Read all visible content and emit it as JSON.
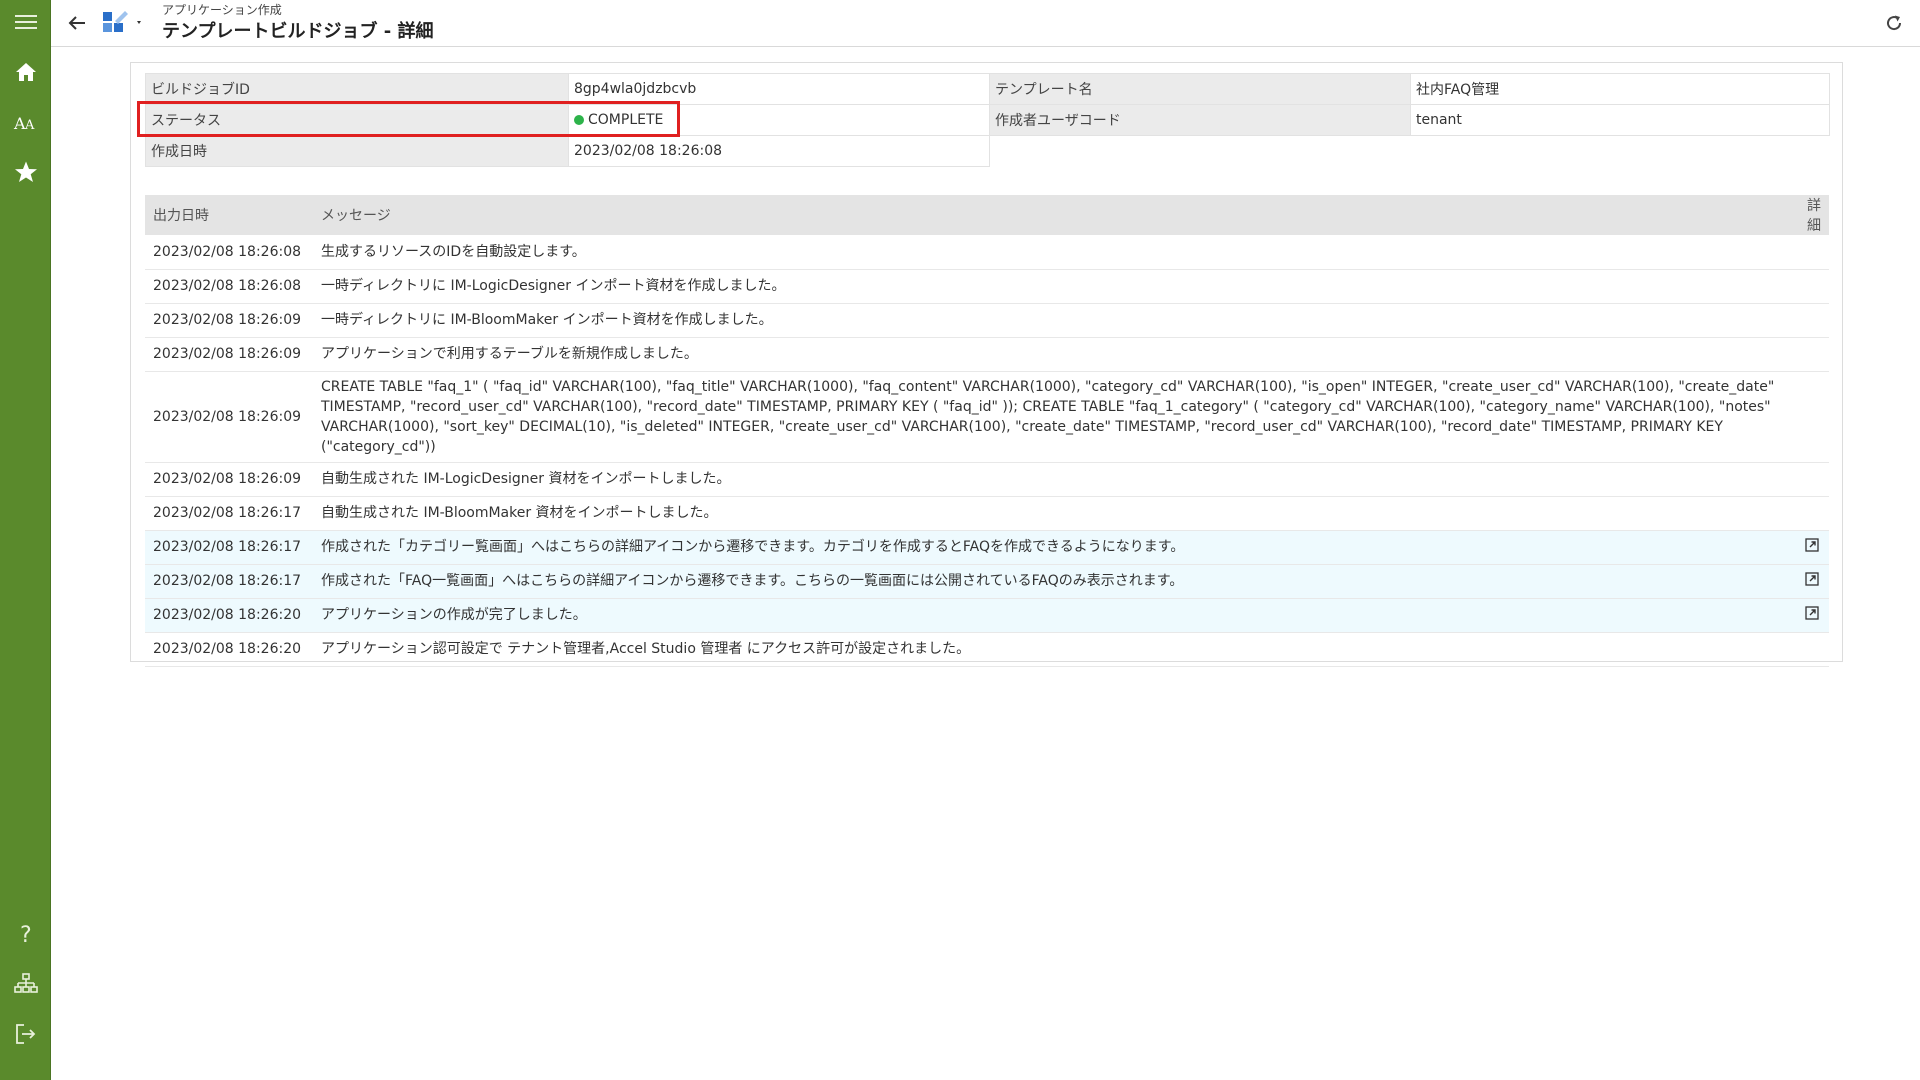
{
  "header": {
    "subtitle": "アプリケーション作成",
    "title": "テンプレートビルドジョブ - 詳細"
  },
  "info": {
    "build_job_id_label": "ビルドジョブID",
    "build_job_id": "8gp4wla0jdzbcvb",
    "status_label": "ステータス",
    "status": "COMPLETE",
    "created_at_label": "作成日時",
    "created_at": "2023/02/08 18:26:08",
    "template_name_label": "テンプレート名",
    "template_name": "社内FAQ管理",
    "creator_label": "作成者ユーザコード",
    "creator": "tenant"
  },
  "messages": {
    "columns": {
      "time": "出力日時",
      "message": "メッセージ",
      "detail": "詳細"
    },
    "rows": [
      {
        "time": "2023/02/08 18:26:08",
        "text": "生成するリソースのIDを自動設定します。",
        "link": false
      },
      {
        "time": "2023/02/08 18:26:08",
        "text": "一時ディレクトリに IM-LogicDesigner インポート資材を作成しました。",
        "link": false
      },
      {
        "time": "2023/02/08 18:26:09",
        "text": "一時ディレクトリに IM-BloomMaker インポート資材を作成しました。",
        "link": false
      },
      {
        "time": "2023/02/08 18:26:09",
        "text": "アプリケーションで利用するテーブルを新規作成しました。",
        "link": false
      },
      {
        "time": "2023/02/08 18:26:09",
        "text": "CREATE TABLE \"faq_1\" ( \"faq_id\" VARCHAR(100), \"faq_title\" VARCHAR(1000), \"faq_content\" VARCHAR(1000), \"category_cd\" VARCHAR(100), \"is_open\" INTEGER, \"create_user_cd\" VARCHAR(100), \"create_date\" TIMESTAMP, \"record_user_cd\" VARCHAR(100), \"record_date\" TIMESTAMP, PRIMARY KEY ( \"faq_id\" )); CREATE TABLE \"faq_1_category\" ( \"category_cd\" VARCHAR(100), \"category_name\" VARCHAR(100), \"notes\" VARCHAR(1000), \"sort_key\" DECIMAL(10), \"is_deleted\" INTEGER, \"create_user_cd\" VARCHAR(100), \"create_date\" TIMESTAMP, \"record_user_cd\" VARCHAR(100), \"record_date\" TIMESTAMP, PRIMARY KEY (\"category_cd\"))",
        "link": false
      },
      {
        "time": "2023/02/08 18:26:09",
        "text": "自動生成された IM-LogicDesigner 資材をインポートしました。",
        "link": false
      },
      {
        "time": "2023/02/08 18:26:17",
        "text": "自動生成された IM-BloomMaker 資材をインポートしました。",
        "link": false
      },
      {
        "time": "2023/02/08 18:26:17",
        "text": "作成された「カテゴリー覧画面」へはこちらの詳細アイコンから遷移できます。カテゴリを作成するとFAQを作成できるようになります。",
        "link": true
      },
      {
        "time": "2023/02/08 18:26:17",
        "text": "作成された「FAQ一覧画面」へはこちらの詳細アイコンから遷移できます。こちらの一覧画面には公開されているFAQのみ表示されます。",
        "link": true
      },
      {
        "time": "2023/02/08 18:26:20",
        "text": "アプリケーションの作成が完了しました。",
        "link": true
      },
      {
        "time": "2023/02/08 18:26:20",
        "text": "アプリケーション認可設定で テナント管理者,Accel Studio 管理者 にアクセス許可が設定されました。",
        "link": false
      }
    ]
  },
  "icons": {
    "menu": "hamburger-menu-icon",
    "home": "home-icon",
    "font": "font-size-icon",
    "favorite": "star-icon",
    "help": "help-icon",
    "sitemap": "sitemap-icon",
    "logout": "logout-icon",
    "back": "back-arrow-icon",
    "app": "application-tools-icon",
    "reload": "reload-icon",
    "external": "external-link-icon"
  },
  "colors": {
    "sidebar": "#5a8a2c",
    "status_ok": "#2db34a",
    "highlight": "#e02020",
    "link_row": "#eefafe"
  }
}
